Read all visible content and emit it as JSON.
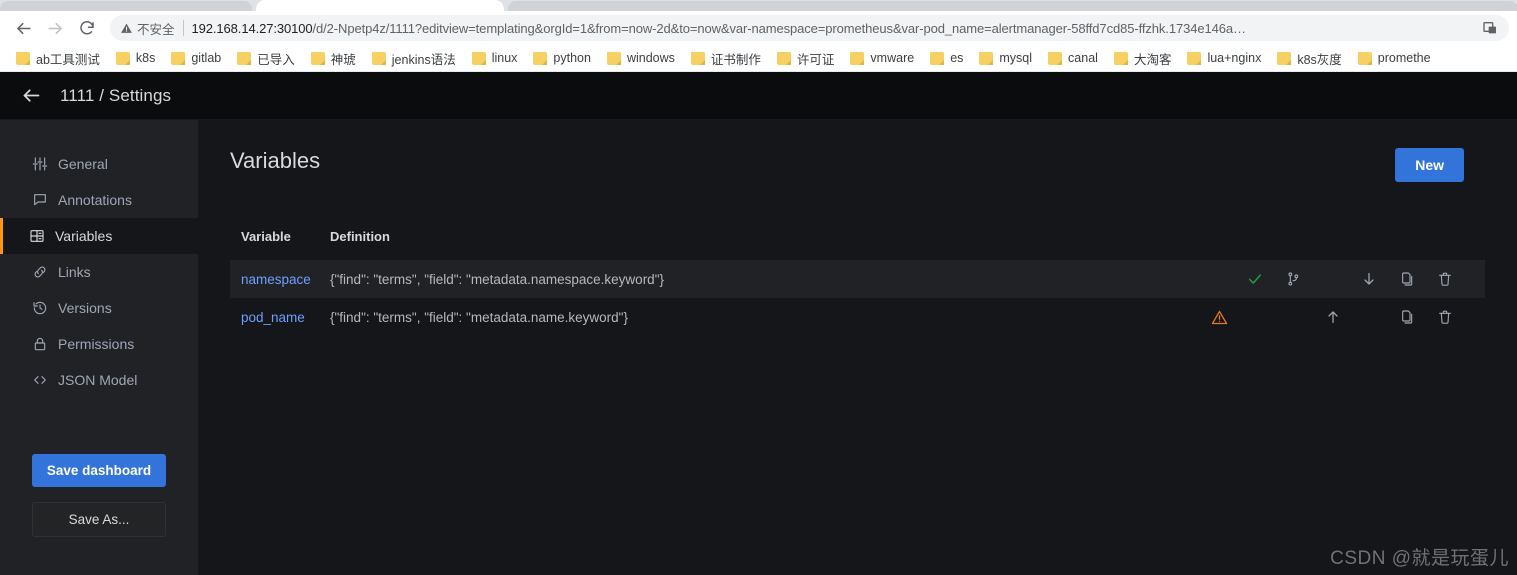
{
  "browser": {
    "nav": {
      "back_icon": "arrow-left-icon",
      "forward_icon": "arrow-right-icon",
      "reload_icon": "reload-icon"
    },
    "omnibox": {
      "security_icon": "warning-triangle-icon",
      "security_label": "不安全",
      "url_prefix": "192.168.14.27:30100",
      "url_rest": "/d/2-Npetp4z/1111?editview=templating&orgId=1&from=now-2d&to=now&var-namespace=prometheus&var-pod_name=alertmanager-58ffd7cd85-ffzhk.1734e146a…",
      "extension_icon": "extension-icon"
    },
    "bookmarks": [
      {
        "label": "ab工具测试",
        "icon": "folder-icon"
      },
      {
        "label": "k8s",
        "icon": "folder-icon"
      },
      {
        "label": "gitlab",
        "icon": "folder-icon"
      },
      {
        "label": "已导入",
        "icon": "folder-icon"
      },
      {
        "label": "神琥",
        "icon": "folder-icon"
      },
      {
        "label": "jenkins语法",
        "icon": "folder-icon"
      },
      {
        "label": "linux",
        "icon": "folder-icon"
      },
      {
        "label": "python",
        "icon": "folder-icon"
      },
      {
        "label": "windows",
        "icon": "folder-icon"
      },
      {
        "label": "证书制作",
        "icon": "folder-icon"
      },
      {
        "label": "许可证",
        "icon": "folder-icon"
      },
      {
        "label": "vmware",
        "icon": "folder-icon"
      },
      {
        "label": "es",
        "icon": "folder-icon"
      },
      {
        "label": "mysql",
        "icon": "folder-icon"
      },
      {
        "label": "canal",
        "icon": "folder-icon"
      },
      {
        "label": "大淘客",
        "icon": "folder-icon"
      },
      {
        "label": "lua+nginx",
        "icon": "folder-icon"
      },
      {
        "label": "k8s灰度",
        "icon": "folder-icon"
      },
      {
        "label": "promethe",
        "icon": "folder-icon"
      }
    ]
  },
  "header": {
    "back_icon": "back-arrow-icon",
    "title": "1111 / Settings"
  },
  "sidebar": {
    "items": [
      {
        "label": "General",
        "icon": "sliders-icon",
        "active": false
      },
      {
        "label": "Annotations",
        "icon": "comment-icon",
        "active": false
      },
      {
        "label": "Variables",
        "icon": "table-icon",
        "active": true
      },
      {
        "label": "Links",
        "icon": "link-icon",
        "active": false
      },
      {
        "label": "Versions",
        "icon": "history-icon",
        "active": false
      },
      {
        "label": "Permissions",
        "icon": "lock-icon",
        "active": false
      },
      {
        "label": "JSON Model",
        "icon": "code-icon",
        "active": false
      }
    ],
    "save_dashboard_label": "Save dashboard",
    "save_as_label": "Save As..."
  },
  "main": {
    "title": "Variables",
    "new_button_label": "New",
    "columns": [
      "Variable",
      "Definition"
    ],
    "rows": [
      {
        "variable": "namespace",
        "definition": "{\"find\": \"terms\", \"field\": \"metadata.namespace.keyword\"}",
        "status_icon": "check-icon",
        "status": "ok",
        "usage_icon": "code-branch-icon",
        "move_icon": "arrow-down-icon",
        "duplicate_icon": "copy-icon",
        "delete_icon": "trash-icon",
        "highlighted": true
      },
      {
        "variable": "pod_name",
        "definition": "{\"find\": \"terms\", \"field\": \"metadata.name.keyword\"}",
        "status_icon": "exclamation-triangle-icon",
        "status": "warn",
        "usage_icon": null,
        "move_icon": "arrow-up-icon",
        "duplicate_icon": "copy-icon",
        "delete_icon": "trash-icon",
        "highlighted": false
      }
    ]
  },
  "watermark": "CSDN @就是玩蛋儿",
  "colors": {
    "accent_blue": "#3274d9",
    "active_orange": "#ff980e",
    "link_blue": "#6e9fff",
    "status_ok": "#299c46",
    "status_warn": "#eb7b18",
    "app_bg": "#141619",
    "sidebar_bg": "#202226",
    "header_bg": "#0b0c0e"
  }
}
